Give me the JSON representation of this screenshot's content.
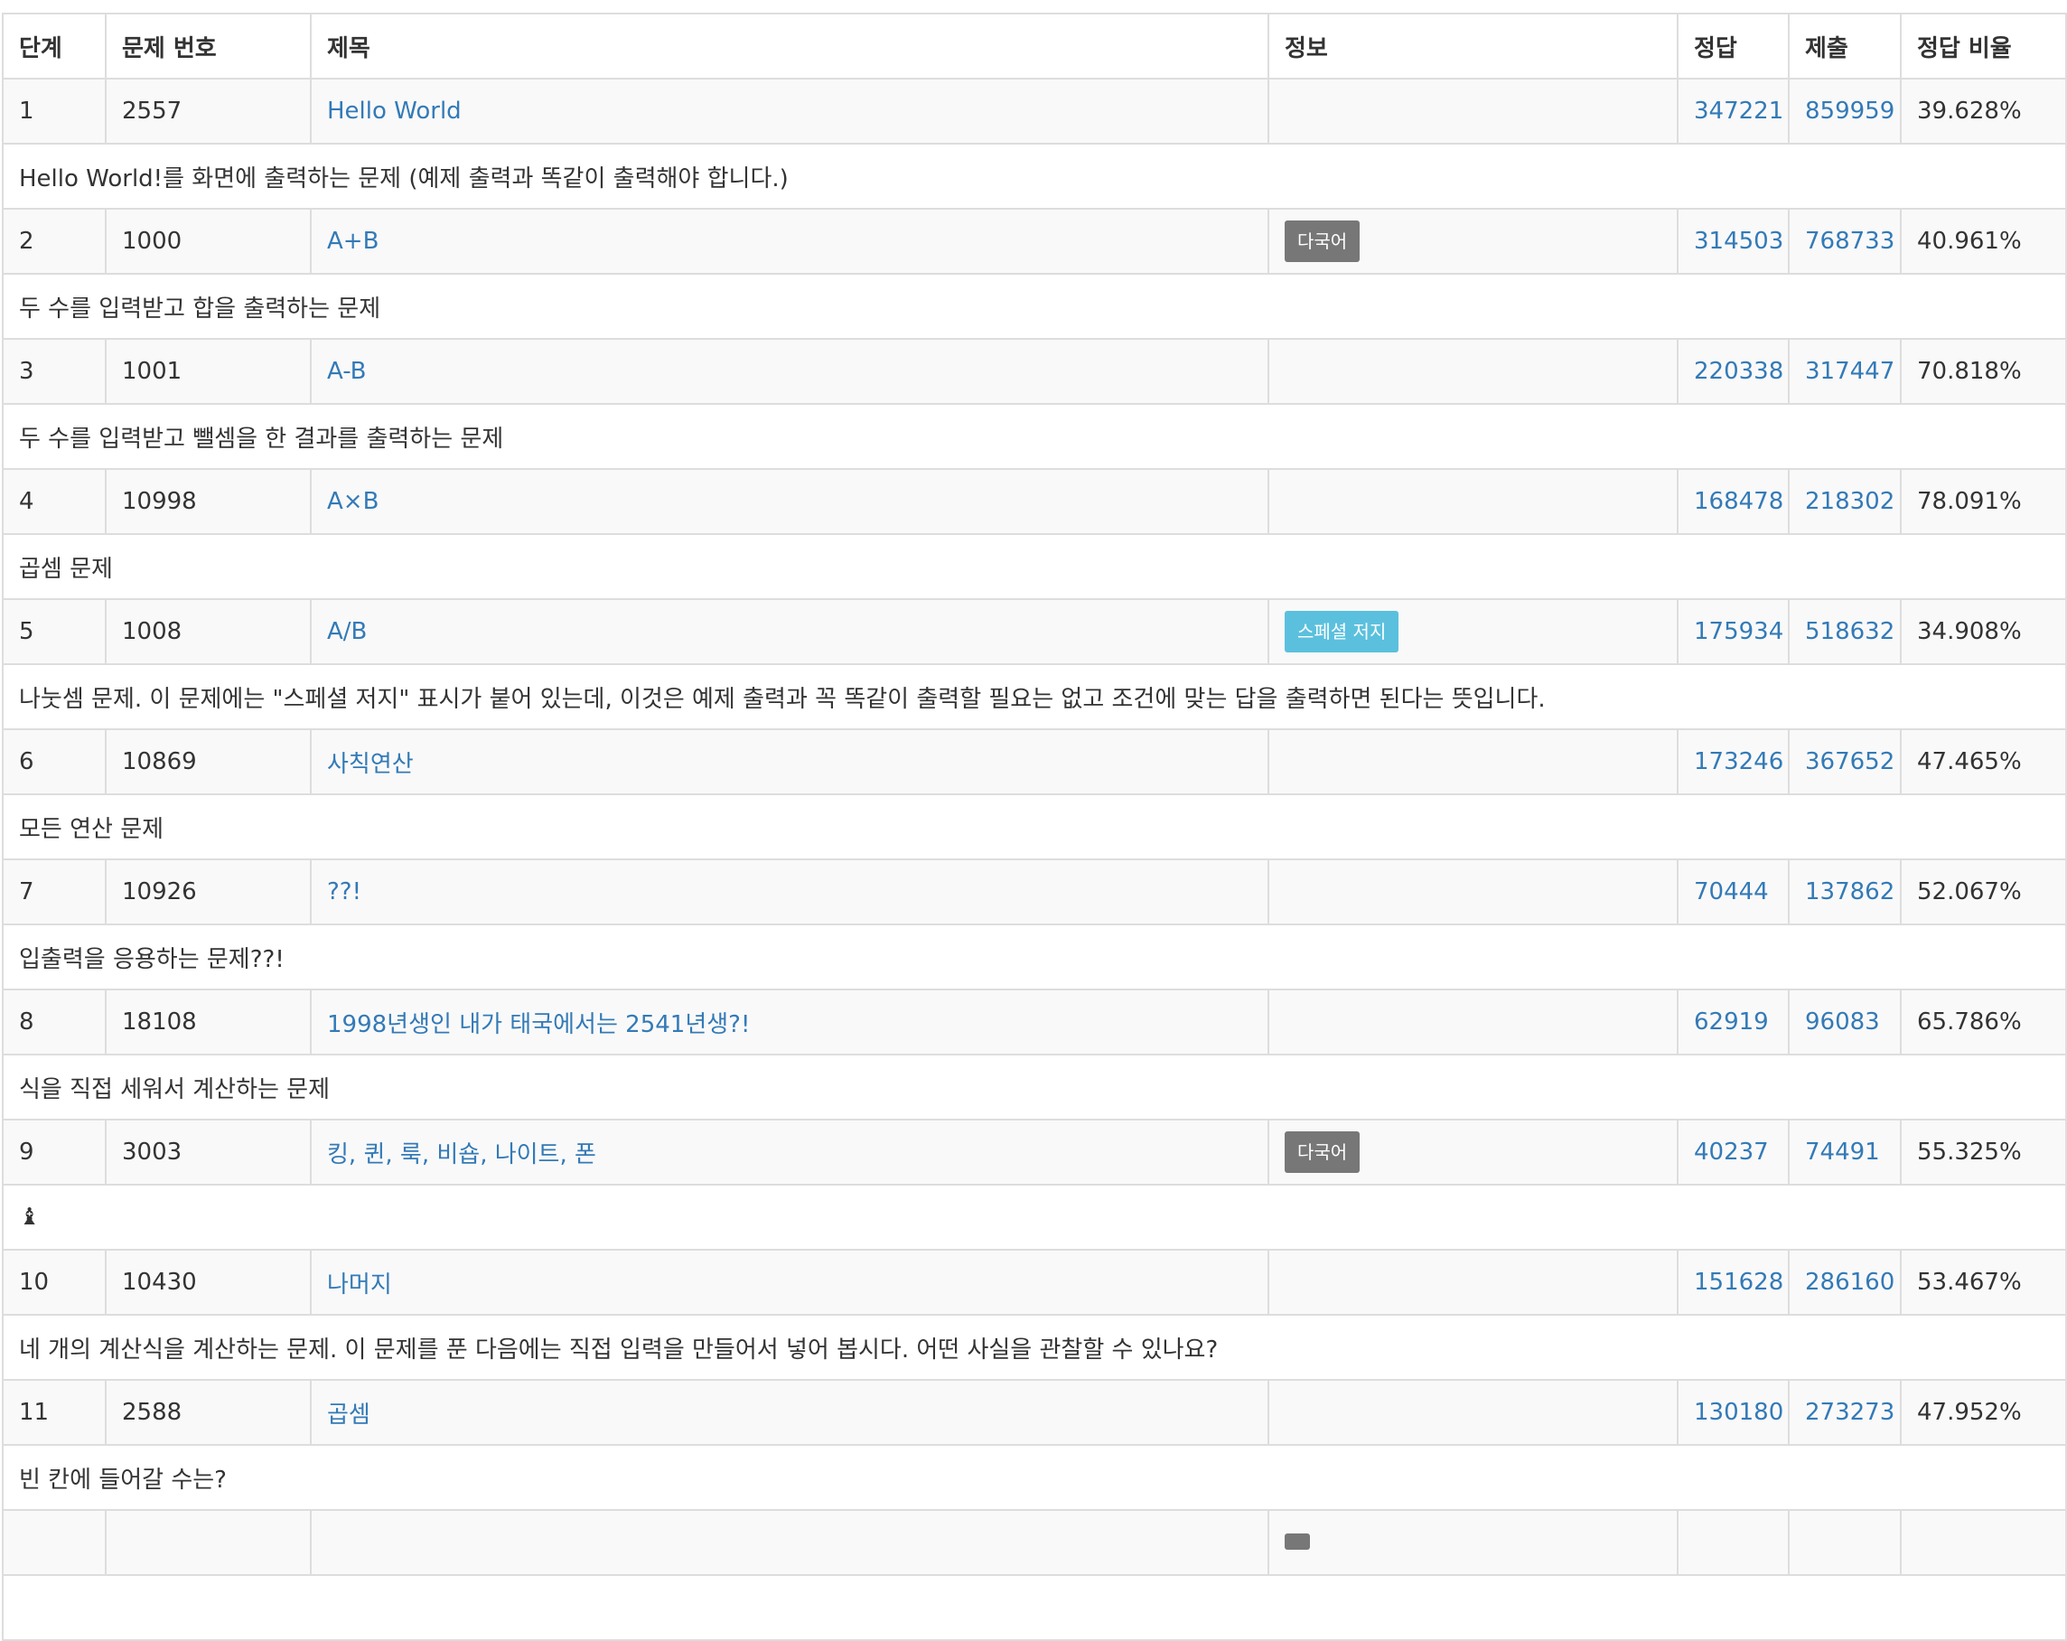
{
  "headers": {
    "step": "단계",
    "problem_id": "문제 번호",
    "title": "제목",
    "info": "정보",
    "accepted": "정답",
    "submissions": "제출",
    "ratio": "정답 비율"
  },
  "colors": {
    "multilingual_badge": "#777777",
    "special_judge_badge": "#5bc0de",
    "link": "#337ab7"
  },
  "problems": [
    {
      "step": "1",
      "id": "2557",
      "title": "Hello World",
      "tags": [],
      "accepted": "347221",
      "submissions": "859959",
      "ratio": "39.628%",
      "desc": "Hello World!를 화면에 출력하는 문제 (예제 출력과 똑같이 출력해야 합니다.)"
    },
    {
      "step": "2",
      "id": "1000",
      "title": "A+B",
      "tags": [
        {
          "text": "다국어",
          "kind": "multilingual"
        }
      ],
      "accepted": "314503",
      "submissions": "768733",
      "ratio": "40.961%",
      "desc": "두 수를 입력받고 합을 출력하는 문제"
    },
    {
      "step": "3",
      "id": "1001",
      "title": "A-B",
      "tags": [],
      "accepted": "220338",
      "submissions": "317447",
      "ratio": "70.818%",
      "desc": "두 수를 입력받고 뺄셈을 한 결과를 출력하는 문제"
    },
    {
      "step": "4",
      "id": "10998",
      "title": "A×B",
      "tags": [],
      "accepted": "168478",
      "submissions": "218302",
      "ratio": "78.091%",
      "desc": "곱셈 문제"
    },
    {
      "step": "5",
      "id": "1008",
      "title": "A/B",
      "tags": [
        {
          "text": "스페셜 저지",
          "kind": "special"
        }
      ],
      "accepted": "175934",
      "submissions": "518632",
      "ratio": "34.908%",
      "desc": "나눗셈 문제. 이 문제에는 \"스페셜 저지\" 표시가 붙어 있는데, 이것은 예제 출력과 꼭 똑같이 출력할 필요는 없고 조건에 맞는 답을 출력하면 된다는 뜻입니다."
    },
    {
      "step": "6",
      "id": "10869",
      "title": "사칙연산",
      "tags": [],
      "accepted": "173246",
      "submissions": "367652",
      "ratio": "47.465%",
      "desc": "모든 연산 문제"
    },
    {
      "step": "7",
      "id": "10926",
      "title": "??!",
      "tags": [],
      "accepted": "70444",
      "submissions": "137862",
      "ratio": "52.067%",
      "desc": "입출력을 응용하는 문제??!"
    },
    {
      "step": "8",
      "id": "18108",
      "title": "1998년생인 내가 태국에서는 2541년생?!",
      "tags": [],
      "accepted": "62919",
      "submissions": "96083",
      "ratio": "65.786%",
      "desc": "식을 직접 세워서 계산하는 문제"
    },
    {
      "step": "9",
      "id": "3003",
      "title": "킹, 퀸, 룩, 비숍, 나이트, 폰",
      "tags": [
        {
          "text": "다국어",
          "kind": "multilingual"
        }
      ],
      "accepted": "40237",
      "submissions": "74491",
      "ratio": "55.325%",
      "desc": "♝"
    },
    {
      "step": "10",
      "id": "10430",
      "title": "나머지",
      "tags": [],
      "accepted": "151628",
      "submissions": "286160",
      "ratio": "53.467%",
      "desc": "네 개의 계산식을 계산하는 문제. 이 문제를 푼 다음에는 직접 입력을 만들어서 넣어 봅시다. 어떤 사실을 관찰할 수 있나요?"
    },
    {
      "step": "11",
      "id": "2588",
      "title": "곱셈",
      "tags": [],
      "accepted": "130180",
      "submissions": "273273",
      "ratio": "47.952%",
      "desc": "빈 칸에 들어갈 수는?"
    },
    {
      "step": "",
      "id": "",
      "title": "",
      "tags": [
        {
          "text": "",
          "kind": "multilingual"
        }
      ],
      "accepted": "",
      "submissions": "",
      "ratio": "",
      "desc": ""
    }
  ]
}
